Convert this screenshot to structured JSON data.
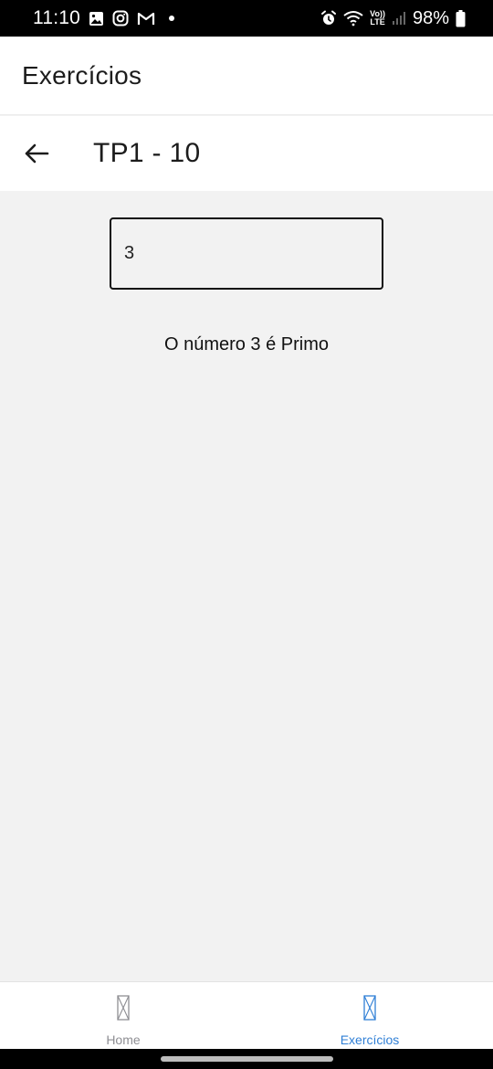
{
  "status_bar": {
    "time": "11:10",
    "left_icons": [
      "gallery-icon",
      "instagram-icon",
      "gmail-icon",
      "notification-dot"
    ],
    "right_icons": [
      "alarm-icon",
      "wifi-icon",
      "volte-icon",
      "signal-icon",
      "battery-icon"
    ],
    "volte_top": "Vo))",
    "volte_bottom": "LTE",
    "battery_percent": "98%"
  },
  "header": {
    "title": "Exercícios"
  },
  "sub_header": {
    "back_icon": "arrow-left-icon",
    "title": "TP1 - 10"
  },
  "content": {
    "input_value": "3",
    "result": "O número 3 é Primo"
  },
  "tab_bar": {
    "tabs": [
      {
        "label": "Home",
        "icon": "missing-image-icon",
        "active": false,
        "color": "#8e8e93"
      },
      {
        "label": "Exercícios",
        "icon": "missing-image-icon",
        "active": true,
        "color": "#2f7fd6"
      }
    ]
  },
  "colors": {
    "background": "#f2f2f2",
    "surface": "#ffffff",
    "accent": "#2f7fd6",
    "inactive": "#8e8e93"
  }
}
